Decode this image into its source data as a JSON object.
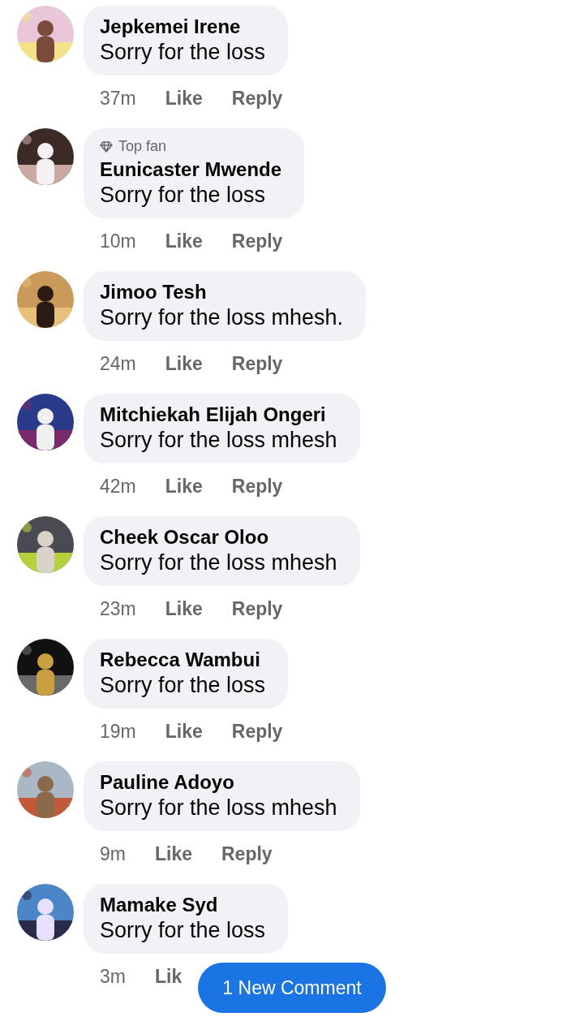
{
  "comments": [
    {
      "name": "Jepkemei Irene",
      "text": "Sorry for the loss",
      "time": "37m",
      "like": "Like",
      "reply": "Reply"
    },
    {
      "badge": "Top fan",
      "name": "Eunicaster Mwende",
      "text": "Sorry for the loss",
      "time": "10m",
      "like": "Like",
      "reply": "Reply"
    },
    {
      "name": "Jimoo Tesh",
      "text": "Sorry for the loss mhesh.",
      "time": "24m",
      "like": "Like",
      "reply": "Reply"
    },
    {
      "name": "Mitchiekah Elijah Ongeri",
      "text": "Sorry for the loss mhesh",
      "time": "42m",
      "like": "Like",
      "reply": "Reply"
    },
    {
      "name": "Cheek Oscar Oloo",
      "text": "Sorry for the loss mhesh",
      "time": "23m",
      "like": "Like",
      "reply": "Reply"
    },
    {
      "name": "Rebecca Wambui",
      "text": "Sorry for the loss",
      "time": "19m",
      "like": "Like",
      "reply": "Reply"
    },
    {
      "name": "Pauline Adoyo",
      "text": "Sorry for the loss mhesh",
      "time": "9m",
      "like": "Like",
      "reply": "Reply"
    },
    {
      "name": "Mamake Syd",
      "text": "Sorry for the loss",
      "time": "3m",
      "like": "Lik"
    }
  ],
  "new_comments_button": "1 New Comment"
}
